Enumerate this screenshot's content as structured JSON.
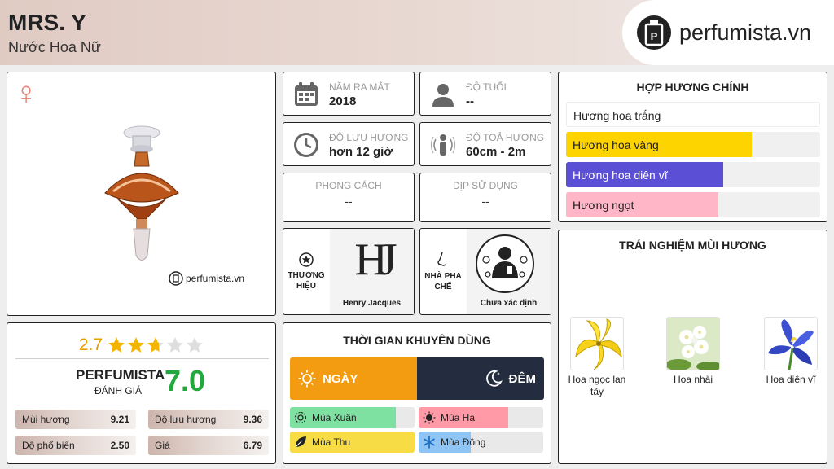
{
  "header": {
    "title": "MRS. Y",
    "subtitle": "Nước Hoa Nữ",
    "logo_text": "perfumista.vn"
  },
  "product": {
    "gender_icon": "female-venus-icon",
    "watermark": "perfumista.vn"
  },
  "info": {
    "year": {
      "label": "NĂM RA MẮT",
      "value": "2018"
    },
    "age": {
      "label": "ĐỘ TUỔI",
      "value": "--"
    },
    "longevity": {
      "label": "ĐỘ LƯU HƯƠNG",
      "value": "hơn 12 giờ"
    },
    "sillage": {
      "label": "ĐỘ TOẢ HƯƠNG",
      "value": "60cm - 2m"
    },
    "style": {
      "label": "PHONG CÁCH",
      "value": "--"
    },
    "occasion": {
      "label": "DỊP SỬ DỤNG",
      "value": "--"
    }
  },
  "brand": {
    "label": "THƯƠNG HIỆU",
    "name": "Henry Jacques",
    "monogram": "HJ"
  },
  "perfumer": {
    "label": "NHÀ PHA CHẾ",
    "name": "Chưa xác định"
  },
  "accords": {
    "title": "HỢP HƯƠNG CHÍNH",
    "items": [
      {
        "label": "Hương hoa trắng",
        "level": 0.0,
        "color": "#ffffff",
        "text_color": "#222222"
      },
      {
        "label": "Hương hoa vàng",
        "level": 0.73,
        "color": "#fdd400",
        "text_color": "#222222"
      },
      {
        "label": "Hương hoa diên vĩ",
        "level": 0.62,
        "color": "#5b4fd6",
        "text_color": "#ffffff"
      },
      {
        "label": "Hương ngọt",
        "level": 0.6,
        "color": "#ffb6c6",
        "text_color": "#222222"
      }
    ]
  },
  "notes": {
    "title": "TRẢI NGHIỆM MÙI HƯƠNG",
    "items": [
      {
        "name": "Hoa ngọc lan tây",
        "icon": "ylang-ylang-flower-icon"
      },
      {
        "name": "Hoa nhài",
        "icon": "jasmine-flower-icon"
      },
      {
        "name": "Hoa diên vĩ",
        "icon": "iris-flower-icon"
      }
    ]
  },
  "rating": {
    "value": "2.7",
    "stars": 2.7,
    "max_stars": 5,
    "brand": "PERFUMISTA",
    "sub": "ĐÁNH GIÁ",
    "score": "7.0",
    "metrics": [
      {
        "label": "Mùi hương",
        "value": "9.21"
      },
      {
        "label": "Độ lưu hương",
        "value": "9.36"
      },
      {
        "label": "Độ phổ biến",
        "value": "2.50"
      },
      {
        "label": "Giá",
        "value": "6.79"
      }
    ]
  },
  "time": {
    "title": "THỜI GIAN KHUYÊN DÙNG",
    "day": "NGÀY",
    "night": "ĐÊM",
    "seasons": [
      {
        "label": "Mùa Xuân",
        "level": 0.85,
        "color": "#7ee0a1",
        "icon": "spring-flower-icon"
      },
      {
        "label": "Mùa Hạ",
        "level": 0.72,
        "color": "#ff9aa6",
        "icon": "sun-icon"
      },
      {
        "label": "Mùa Thu",
        "level": 1.0,
        "color": "#f7dc45",
        "icon": "leaf-icon"
      },
      {
        "label": "Mùa Đông",
        "level": 0.42,
        "color": "#8ec5f5",
        "icon": "snowflake-icon"
      }
    ]
  },
  "colors": {
    "accent_day": "#f39c12",
    "accent_night": "#232d3f",
    "score_green": "#22a83c",
    "star": "#f5b400"
  }
}
